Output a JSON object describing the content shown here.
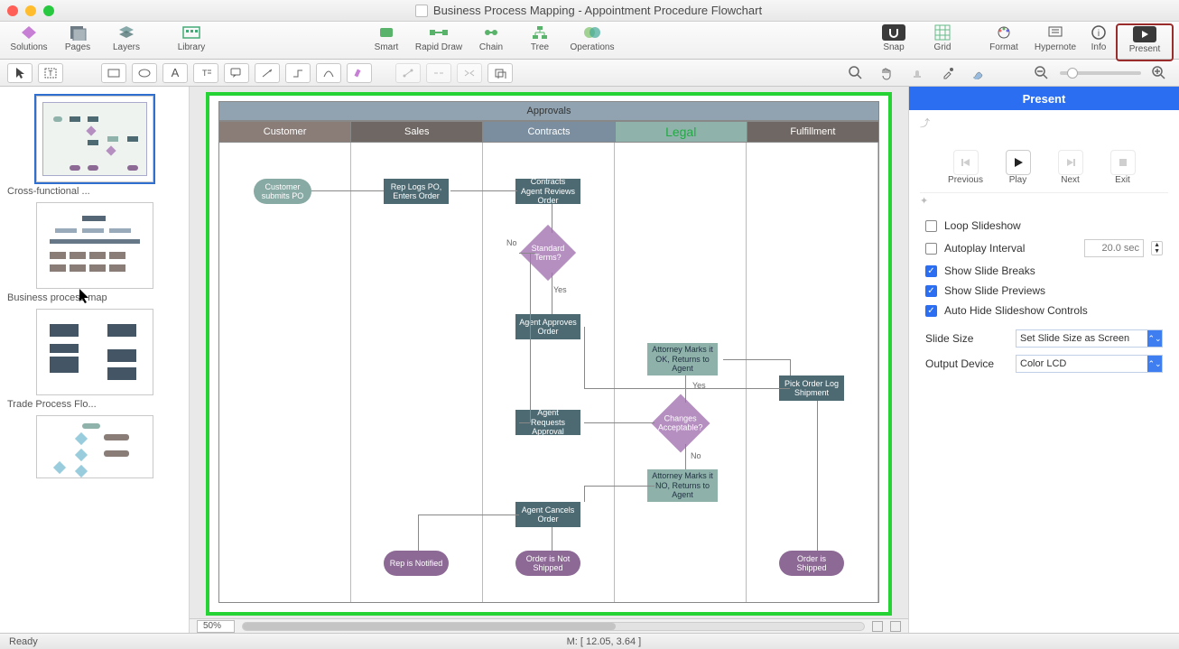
{
  "window": {
    "title": "Business Process Mapping - Appointment Procedure Flowchart"
  },
  "toolbar": {
    "solutions": "Solutions",
    "pages": "Pages",
    "layers": "Layers",
    "library": "Library",
    "smart": "Smart",
    "rapid_draw": "Rapid Draw",
    "chain": "Chain",
    "tree": "Tree",
    "operations": "Operations",
    "snap": "Snap",
    "grid": "Grid",
    "format": "Format",
    "hypernote": "Hypernote",
    "info": "Info",
    "present": "Present"
  },
  "thumbnails": [
    {
      "caption": "Cross-functional ..."
    },
    {
      "caption": "Business process map"
    },
    {
      "caption": "Trade Process Flo..."
    },
    {
      "caption": ""
    }
  ],
  "diagram": {
    "title": "Approvals",
    "lanes": [
      "Customer",
      "Sales",
      "Contracts",
      "Legal",
      "Fulfillment"
    ],
    "lane_colors": [
      "#8a7d78",
      "#6f6763",
      "#7a8ea0",
      "#8fb3aa",
      "#6f6763"
    ],
    "nodes": {
      "customer_submits": "Customer submits PO",
      "rep_logs": "Rep Logs PO, Enters Order",
      "contracts_review": "Contracts Agent Reviews Order",
      "standard_terms": "Standard Terms?",
      "agent_approves": "Agent Approves Order",
      "agent_requests": "Agent Requests Approval",
      "agent_cancels": "Agent Cancels Order",
      "attorney_ok": "Attorney Marks it OK, Returns to Agent",
      "changes_acc": "Changes Acceptable?",
      "attorney_no": "Attorney Marks it NO, Returns to Agent",
      "pick_order": "Pick Order Log Shipment",
      "rep_notified": "Rep is Notified",
      "order_not_shipped": "Order is Not Shipped",
      "order_shipped": "Order is Shipped"
    },
    "edge_labels": {
      "no1": "No",
      "yes1": "Yes",
      "yes2": "Yes",
      "no2": "No"
    }
  },
  "canvas": {
    "zoom": "50%",
    "mouse": "M: [ 12.05, 3.64 ]"
  },
  "inspector": {
    "header": "Present",
    "controls": {
      "previous": "Previous",
      "play": "Play",
      "next": "Next",
      "exit": "Exit"
    },
    "options": {
      "loop": "Loop Slideshow",
      "autoplay": "Autoplay Interval",
      "autoplay_value": "20.0 sec",
      "breaks": "Show Slide Breaks",
      "previews": "Show Slide Previews",
      "autohide": "Auto Hide Slideshow Controls"
    },
    "slide_size_label": "Slide Size",
    "slide_size_value": "Set Slide Size as Screen",
    "output_device_label": "Output Device",
    "output_device_value": "Color LCD"
  },
  "status": {
    "ready": "Ready"
  }
}
